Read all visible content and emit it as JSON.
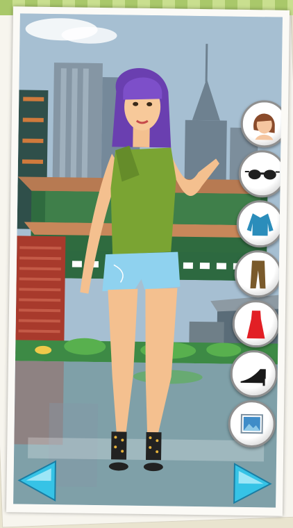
{
  "game": {
    "category_buttons": [
      {
        "id": "hair",
        "icon": "hairstyle-icon"
      },
      {
        "id": "accessories",
        "icon": "sunglasses-icon"
      },
      {
        "id": "tops",
        "icon": "blouse-icon"
      },
      {
        "id": "pants",
        "icon": "trousers-icon"
      },
      {
        "id": "dresses",
        "icon": "dress-icon"
      },
      {
        "id": "shoes",
        "icon": "high-heel-shoe-icon"
      },
      {
        "id": "background",
        "icon": "picture-icon"
      }
    ],
    "navigation": {
      "prev_icon": "arrow-left-icon",
      "next_icon": "arrow-right-icon"
    },
    "colors": {
      "sky": "#a3bcd0",
      "hair": "#6a3fb0",
      "top": "#7aa433",
      "shorts": "#8fd2ef",
      "arrow": "#36c3e6",
      "ground_water": "#7fa0a8"
    }
  }
}
